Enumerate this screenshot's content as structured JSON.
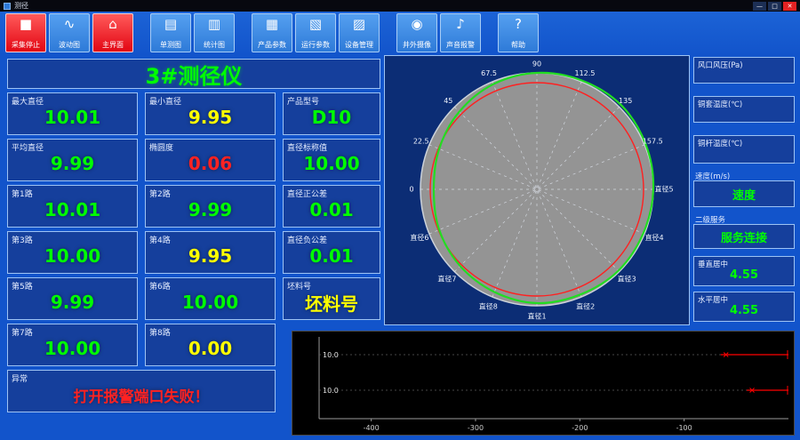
{
  "window": {
    "title": "测径",
    "minimize": "—",
    "maximize": "□",
    "close": "✕"
  },
  "toolbar": {
    "buttons": [
      {
        "name": "stop-acquisition",
        "label": "采集停止",
        "glyph": "■",
        "variant": "red"
      },
      {
        "name": "fluctuation-chart",
        "label": "波动图",
        "glyph": "∿",
        "variant": "blue"
      },
      {
        "name": "main-screen",
        "label": "主界面",
        "glyph": "⌂",
        "variant": "red"
      },
      {
        "name": "single-measure-chart",
        "label": "单测图",
        "glyph": "▤",
        "variant": "blue"
      },
      {
        "name": "statistics-chart",
        "label": "统计图",
        "glyph": "▥",
        "variant": "blue"
      },
      {
        "name": "product-params",
        "label": "产品参数",
        "glyph": "▦",
        "variant": "blue"
      },
      {
        "name": "run-params",
        "label": "运行参数",
        "glyph": "▧",
        "variant": "blue"
      },
      {
        "name": "device-management",
        "label": "设备管理",
        "glyph": "▨",
        "variant": "blue"
      },
      {
        "name": "external-camera",
        "label": "井外摄像",
        "glyph": "◉",
        "variant": "blue"
      },
      {
        "name": "sound-alarm",
        "label": "声音报警",
        "glyph": "♪",
        "variant": "blue"
      },
      {
        "name": "help",
        "label": "帮助",
        "glyph": "?",
        "variant": "blue"
      }
    ]
  },
  "left_panel": {
    "title": "3#测径仪",
    "title_color": "#00ff00",
    "cells": [
      {
        "name": "max-diameter",
        "label": "最大直径",
        "value": "10.01",
        "color": "#00ff00"
      },
      {
        "name": "min-diameter",
        "label": "最小直径",
        "value": "9.95",
        "color": "#ffff00"
      },
      {
        "name": "product-model",
        "label": "产品型号",
        "value": "D10",
        "color": "#00ff00"
      },
      {
        "name": "avg-diameter",
        "label": "平均直径",
        "value": "9.99",
        "color": "#00ff00"
      },
      {
        "name": "ovality",
        "label": "椭圆度",
        "value": "0.06",
        "color": "#ff2222"
      },
      {
        "name": "nominal-diameter",
        "label": "直径标称值",
        "value": "10.00",
        "color": "#00ff00"
      },
      {
        "name": "channel-1",
        "label": "第1路",
        "value": "10.01",
        "color": "#00ff00"
      },
      {
        "name": "channel-2",
        "label": "第2路",
        "value": "9.99",
        "color": "#00ff00"
      },
      {
        "name": "plus-tolerance",
        "label": "直径正公差",
        "value": "0.01",
        "color": "#00ff00"
      },
      {
        "name": "channel-3",
        "label": "第3路",
        "value": "10.00",
        "color": "#00ff00"
      },
      {
        "name": "channel-4",
        "label": "第4路",
        "value": "9.95",
        "color": "#ffff00"
      },
      {
        "name": "minus-tolerance",
        "label": "直径负公差",
        "value": "0.01",
        "color": "#00ff00"
      },
      {
        "name": "channel-5",
        "label": "第5路",
        "value": "9.99",
        "color": "#00ff00"
      },
      {
        "name": "channel-6",
        "label": "第6路",
        "value": "10.00",
        "color": "#00ff00"
      },
      {
        "name": "billet-number",
        "label": "坯料号",
        "value": "坯料号",
        "color": "#ffff00"
      },
      {
        "name": "channel-7",
        "label": "第7路",
        "value": "10.00",
        "color": "#00ff00"
      },
      {
        "name": "channel-8",
        "label": "第8路",
        "value": "0.00",
        "color": "#ffff00"
      },
      {
        "name": "abnormal-status",
        "label": "异常",
        "value": "打开报警端口失败！",
        "color": "#ff2222"
      }
    ]
  },
  "right_panel": {
    "items": [
      {
        "label": "风口风压(Pa)",
        "value": "",
        "color": "#00ff00"
      },
      {
        "label": "铜套温度(℃)",
        "value": "",
        "color": "#00ff00"
      },
      {
        "label": "铜杆温度(℃)",
        "value": "",
        "color": "#00ff00"
      },
      {
        "label": "速度(m/s)",
        "value": "速度",
        "color": "#00ff00"
      },
      {
        "label": "二级服务",
        "value": "服务连接",
        "color": "#00ff00"
      },
      {
        "label": "垂直居中",
        "value": "4.55",
        "color": "#00ff00"
      },
      {
        "label": "水平居中",
        "value": "4.55",
        "color": "#00ff00"
      }
    ]
  },
  "chart_data": [
    {
      "type": "polar",
      "title": "",
      "upper_angle_labels": [
        "0",
        "22.5",
        "45",
        "67.5",
        "90",
        "112.5",
        "135",
        "157.5"
      ],
      "lower_diameter_labels": [
        "直径5",
        "直径4",
        "直径3",
        "直径2",
        "直径1",
        "直径8",
        "直径7",
        "直径6"
      ],
      "nominal_diameter": 10.0,
      "profile_values": [
        10.04,
        10.05,
        10.06,
        10.05,
        10.04,
        10.03,
        10.03,
        10.02,
        10.02,
        10.0,
        9.98,
        9.96,
        9.94,
        9.96,
        9.99,
        10.02
      ],
      "profile_color": "#22dd22",
      "nominal_color": "#ff2020",
      "disc_color": "#949494",
      "spoke_style": "dashed"
    },
    {
      "type": "line",
      "title": "",
      "x_ticks": [
        "-400",
        "-300",
        "-200",
        "-100"
      ],
      "x_range": [
        -450,
        0
      ],
      "y_tick_labels": [
        "10.0",
        "10.0"
      ],
      "series": [
        {
          "name": "upper-trace",
          "color": "#ff0000",
          "x": [
            -65,
            0
          ],
          "y_level": 0
        },
        {
          "name": "lower-trace",
          "color": "#ff0000",
          "x": [
            -40,
            0
          ],
          "y_level": 1
        }
      ],
      "background": "#000000",
      "grid": "dotted"
    }
  ]
}
